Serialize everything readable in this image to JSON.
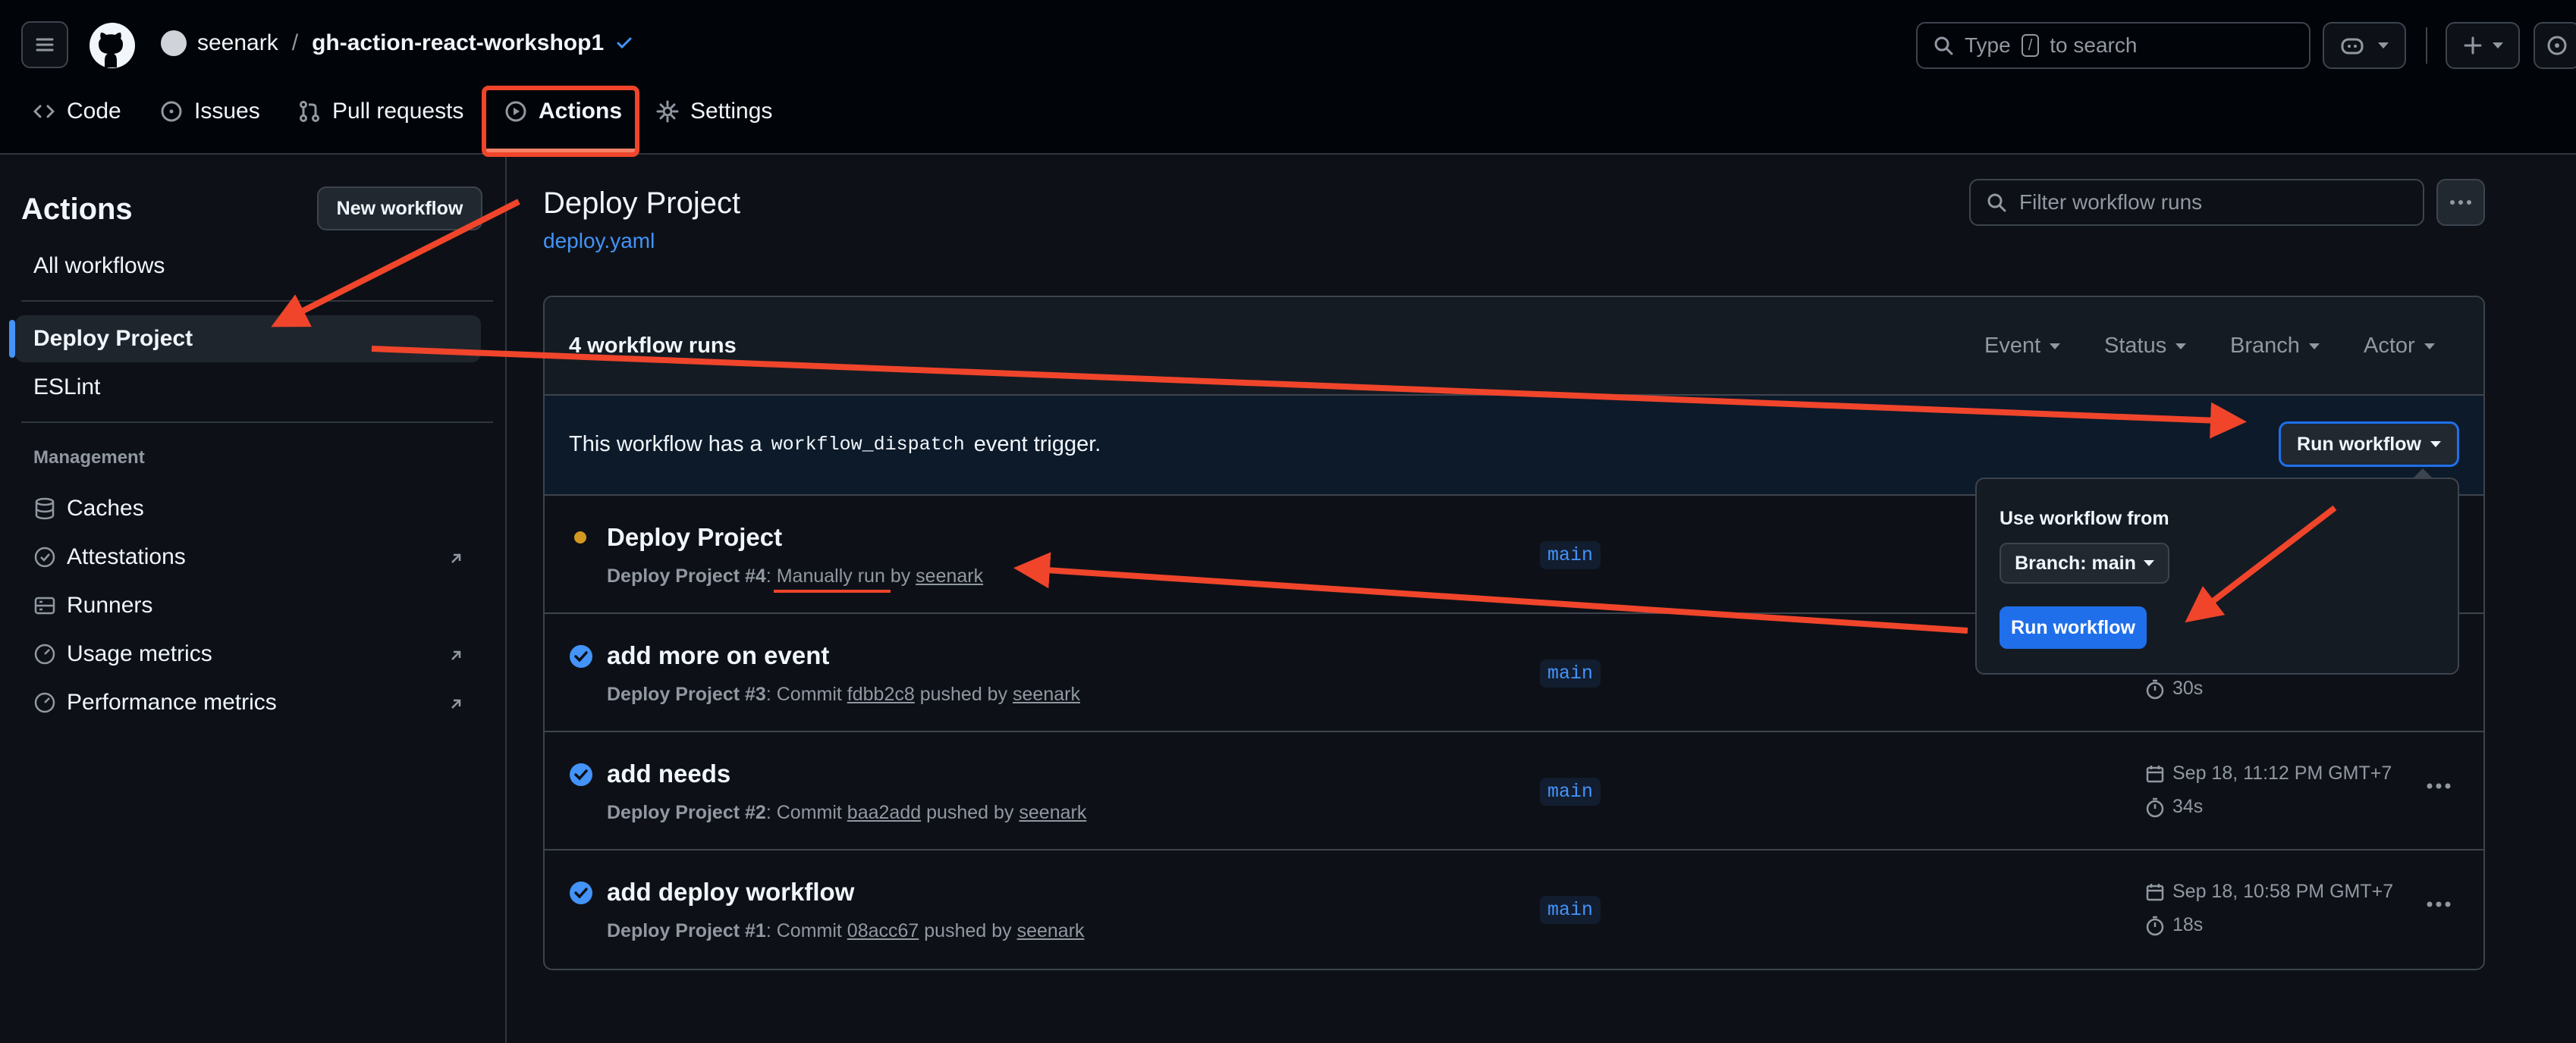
{
  "header": {
    "owner": "seenark",
    "separator": "/",
    "repo": "gh-action-react-workshop1",
    "search_prefix": "Type",
    "search_key": "/",
    "search_suffix": "to search"
  },
  "tabs": [
    {
      "label": "Code"
    },
    {
      "label": "Issues"
    },
    {
      "label": "Pull requests"
    },
    {
      "label": "Actions"
    },
    {
      "label": "Settings"
    }
  ],
  "sidebar": {
    "title": "Actions",
    "new_workflow": "New workflow",
    "all_workflows": "All workflows",
    "workflows": [
      {
        "label": "Deploy Project"
      },
      {
        "label": "ESLint"
      }
    ],
    "management_heading": "Management",
    "management": [
      {
        "label": "Caches"
      },
      {
        "label": "Attestations"
      },
      {
        "label": "Runners"
      },
      {
        "label": "Usage metrics"
      },
      {
        "label": "Performance metrics"
      }
    ]
  },
  "main": {
    "title": "Deploy Project",
    "file": "deploy.yaml",
    "filter_placeholder": "Filter workflow runs",
    "run_count": "4 workflow runs",
    "filters": [
      "Event",
      "Status",
      "Branch",
      "Actor"
    ],
    "dispatch_pre": "This workflow has a",
    "dispatch_code": "workflow_dispatch",
    "dispatch_post": "event trigger.",
    "run_workflow": "Run workflow",
    "runs": [
      {
        "title": "Deploy Project",
        "workflow": "Deploy Project",
        "number": "#4",
        "detail_pre": "Manually run",
        "detail_mid": " by ",
        "actor": "seenark",
        "branch": "main",
        "date": "",
        "duration": ""
      },
      {
        "title": "add more on event",
        "workflow": "Deploy Project",
        "number": "#3",
        "detail_pre": "Commit ",
        "sha": "fdbb2c8",
        "detail_mid": " pushed by ",
        "actor": "seenark",
        "branch": "main",
        "date": "",
        "duration": "30s"
      },
      {
        "title": "add needs",
        "workflow": "Deploy Project",
        "number": "#2",
        "detail_pre": "Commit ",
        "sha": "baa2add",
        "detail_mid": " pushed by ",
        "actor": "seenark",
        "branch": "main",
        "date": "Sep 18, 11:12 PM GMT+7",
        "duration": "34s"
      },
      {
        "title": "add deploy workflow",
        "workflow": "Deploy Project",
        "number": "#1",
        "detail_pre": "Commit ",
        "sha": "08acc67",
        "detail_mid": " pushed by ",
        "actor": "seenark",
        "branch": "main",
        "date": "Sep 18, 10:58 PM GMT+7",
        "duration": "18s"
      }
    ]
  },
  "dropdown": {
    "label": "Use workflow from",
    "branch_select": "Branch: main",
    "run_button": "Run workflow"
  },
  "colors": {
    "accent": "#1f6feb",
    "link": "#4493f8",
    "success": "#4493f8",
    "in_progress": "#d29922",
    "annotation": "#f0452b"
  }
}
